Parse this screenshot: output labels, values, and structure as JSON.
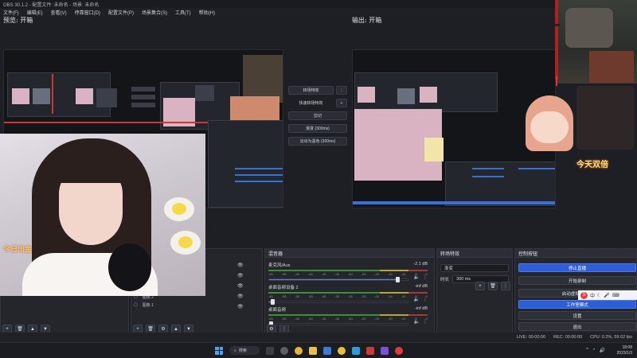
{
  "window": {
    "title": "OBS 30.1.2 - 配置文件: 未命名 - 场景: 未命名"
  },
  "menu": [
    "文件(F)",
    "编辑(E)",
    "查看(V)",
    "停靠窗口(D)",
    "配置文件(P)",
    "场景集合(S)",
    "工具(T)",
    "帮助(H)"
  ],
  "preview": {
    "label": "预览: 开箱"
  },
  "program": {
    "label": "输出: 开箱"
  },
  "transition_mini": {
    "studio_label": "转场特效",
    "quick_label": "快速转场特效",
    "cut_label": "剪切",
    "fade_label": "渐变 (300ms)",
    "fade_black_label": "淡出为黑色 (300ms)"
  },
  "overlays": {
    "webcam_caption": "今日出金",
    "program_caption": "今天双倍"
  },
  "mixer": {
    "title": "混音器",
    "channels": [
      {
        "name": "麦克风/Aux",
        "db": "-2.1 dB",
        "level": 0.92
      },
      {
        "name": "桌面音频设备 2",
        "db": "-inf dB",
        "level": 0.03
      },
      {
        "name": "桌面音频",
        "db": "-inf dB",
        "level": 0.0
      }
    ],
    "scale": [
      "-60",
      "-55",
      "-50",
      "-45",
      "-40",
      "-35",
      "-30",
      "-25",
      "-20",
      "-15",
      "-10",
      "-5",
      "0"
    ]
  },
  "transitions": {
    "title": "转场特效",
    "selected": "渐变",
    "duration_label": "时长",
    "duration_value": "300 ms"
  },
  "controls": {
    "title": "控制按钮",
    "stop_stream": "停止直播",
    "start_record": "开始录制",
    "virtual_cam": "启动虚拟摄像机",
    "studio_mode": "工作室模式",
    "settings": "设置",
    "exit": "退出"
  },
  "scenes_list": [
    "图像 2",
    "图像 1"
  ],
  "status": {
    "live": "LIVE: 00:00:00",
    "rec": "REC: 00:00:00",
    "cpu": "CPU: 0.2%, 59.02 fps"
  },
  "taskbar": {
    "search": "搜索",
    "time": "18:08",
    "date": "2023/1/3"
  },
  "colors": {
    "accent": "#2d5ed8",
    "meter_green": "#3c8f35",
    "meter_yellow": "#b5a534",
    "meter_red": "#a63a2f"
  }
}
